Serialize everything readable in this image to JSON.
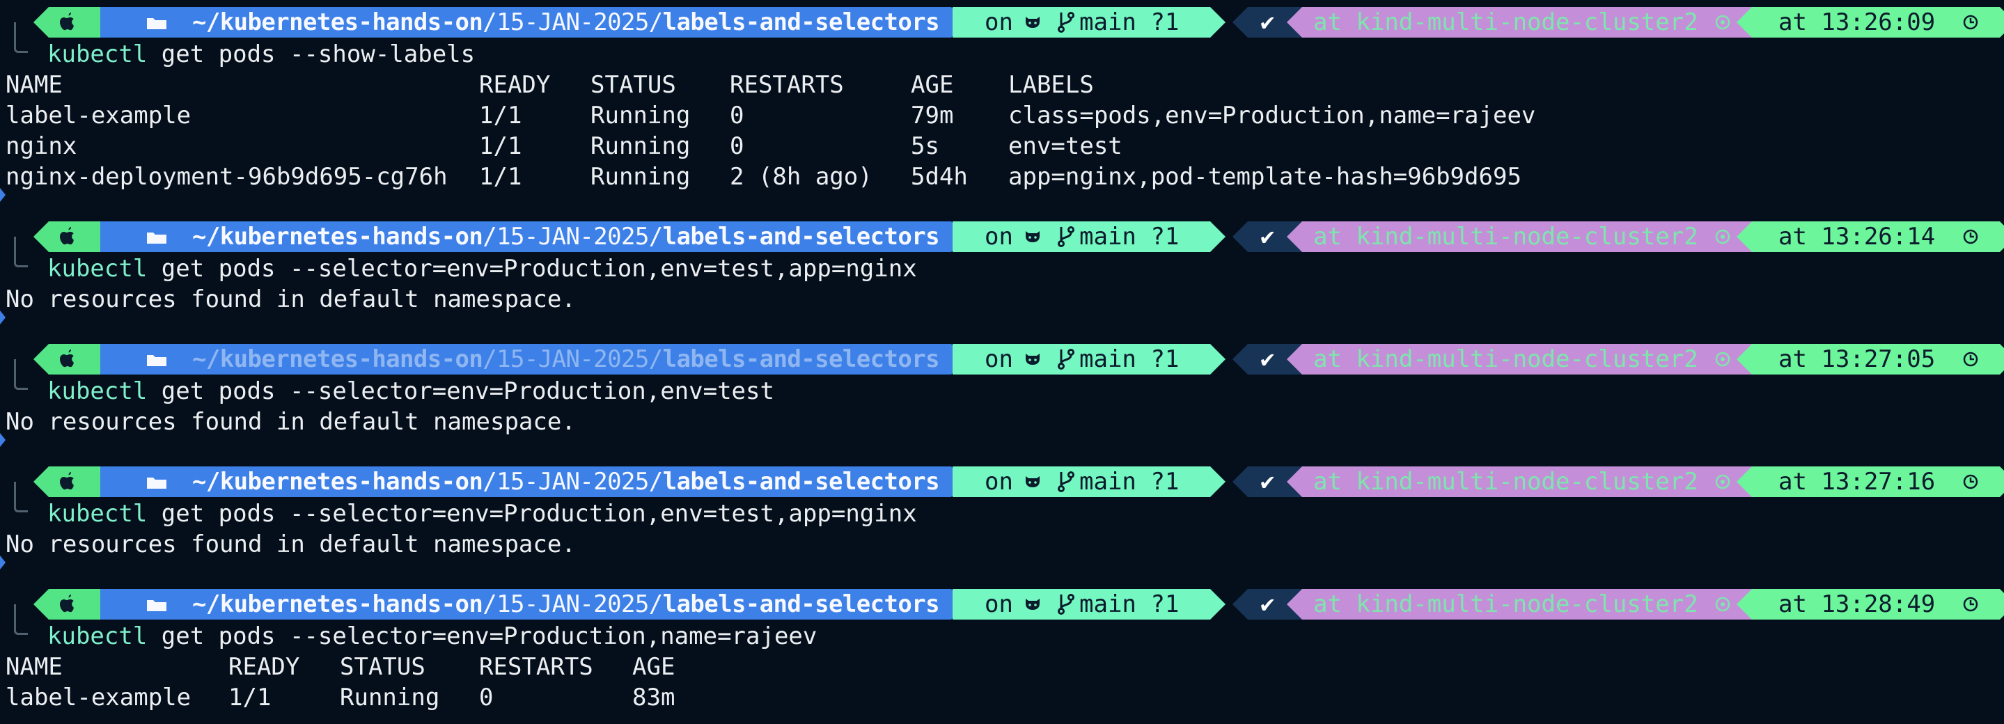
{
  "colors": {
    "background": "#050f1c",
    "os_segment": "#53e486",
    "path_segment": "#3c80e8",
    "git_segment": "#74f7c0",
    "status_segment": "#173456",
    "context_segment": "#c48fd8",
    "time_segment": "#6cf59b",
    "command_keyword": "#7ff0c9"
  },
  "icons": {
    "os": "apple-icon",
    "folder": "folder-icon",
    "vcs": "github-icon",
    "branch": "git-branch-icon",
    "status": "check-icon",
    "context": "kubernetes-icon",
    "time": "clock-icon"
  },
  "prompts": [
    {
      "path_prefix": "~/",
      "path_repo": "kubernetes-hands-on",
      "path_mid": "/15-JAN-2025/",
      "path_dir": "labels-and-selectors",
      "git_on": "on",
      "git_branch": "main ?1",
      "status_mark": "✔",
      "context": "at kind-multi-node-cluster2",
      "time": "at 13:26:09",
      "cmd_keyword": "kubectl",
      "cmd_args": " get pods --show-labels"
    },
    {
      "path_prefix": "~/",
      "path_repo": "kubernetes-hands-on",
      "path_mid": "/15-JAN-2025/",
      "path_dir": "labels-and-selectors",
      "git_on": "on",
      "git_branch": "main ?1",
      "status_mark": "✔",
      "context": "at kind-multi-node-cluster2",
      "time": "at 13:26:14",
      "cmd_keyword": "kubectl",
      "cmd_args": " get pods --selector=env=Production,env=test,app=nginx"
    },
    {
      "path_prefix": "~/",
      "path_repo": "kubernetes-hands-on",
      "path_mid": "/15-JAN-2025/",
      "path_dir": "labels-and-selectors",
      "git_on": "on",
      "git_branch": "main ?1",
      "status_mark": "✔",
      "context": "at kind-multi-node-cluster2",
      "time": "at 13:27:05",
      "cmd_keyword": "kubectl",
      "cmd_args": " get pods --selector=env=Production,env=test"
    },
    {
      "path_prefix": "~/",
      "path_repo": "kubernetes-hands-on",
      "path_mid": "/15-JAN-2025/",
      "path_dir": "labels-and-selectors",
      "git_on": "on",
      "git_branch": "main ?1",
      "status_mark": "✔",
      "context": "at kind-multi-node-cluster2",
      "time": "at 13:27:16",
      "cmd_keyword": "kubectl",
      "cmd_args": " get pods --selector=env=Production,env=test,app=nginx"
    },
    {
      "path_prefix": "~/",
      "path_repo": "kubernetes-hands-on",
      "path_mid": "/15-JAN-2025/",
      "path_dir": "labels-and-selectors",
      "git_on": "on",
      "git_branch": "main ?1",
      "status_mark": "✔",
      "context": "at kind-multi-node-cluster2",
      "time": "at 13:28:49",
      "cmd_keyword": "kubectl",
      "cmd_args": " get pods --selector=env=Production,name=rajeev"
    }
  ],
  "outputs": {
    "show_labels_table": {
      "headers": [
        "NAME",
        "READY",
        "STATUS",
        "RESTARTS",
        "AGE",
        "LABELS"
      ],
      "rows": [
        [
          "label-example",
          "1/1",
          "Running",
          "0",
          "79m",
          "class=pods,env=Production,name=rajeev"
        ],
        [
          "nginx",
          "1/1",
          "Running",
          "0",
          "5s",
          "env=test"
        ],
        [
          "nginx-deployment-96b9d695-cg76h",
          "1/1",
          "Running",
          "2 (8h ago)",
          "5d4h",
          "app=nginx,pod-template-hash=96b9d695"
        ]
      ]
    },
    "no_resources_1": "No resources found in default namespace.",
    "no_resources_2": "No resources found in default namespace.",
    "no_resources_3": "No resources found in default namespace.",
    "selector_table": {
      "headers": [
        "NAME",
        "READY",
        "STATUS",
        "RESTARTS",
        "AGE"
      ],
      "rows": [
        [
          "label-example",
          "1/1",
          "Running",
          "0",
          "83m"
        ]
      ]
    }
  }
}
